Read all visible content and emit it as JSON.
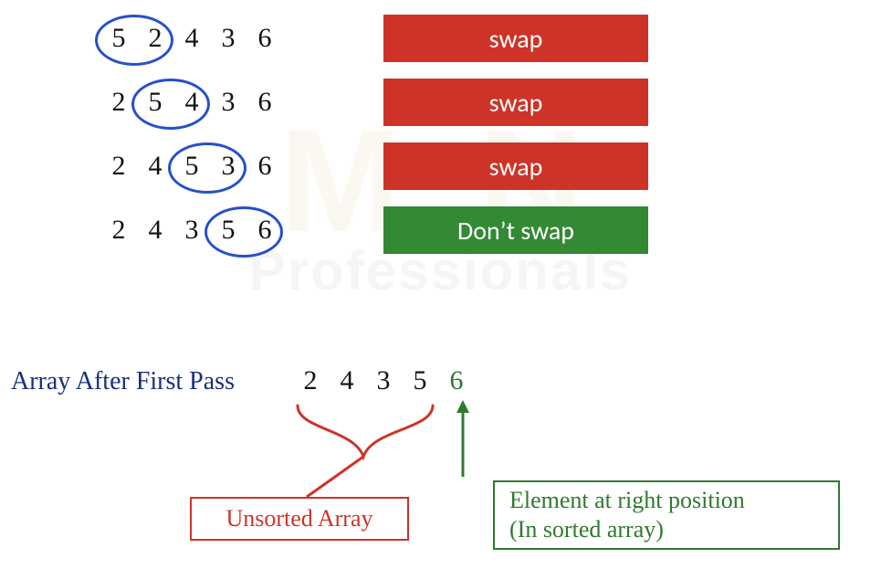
{
  "steps": [
    {
      "array": [
        "5",
        "2",
        "4",
        "3",
        "6"
      ],
      "circle": {
        "startIndex": 0,
        "span": 2
      },
      "action": "swap",
      "swap": true
    },
    {
      "array": [
        "2",
        "5",
        "4",
        "3",
        "6"
      ],
      "circle": {
        "startIndex": 1,
        "span": 2
      },
      "action": "swap",
      "swap": true
    },
    {
      "array": [
        "2",
        "4",
        "5",
        "3",
        "6"
      ],
      "circle": {
        "startIndex": 2,
        "span": 2
      },
      "action": "swap",
      "swap": true
    },
    {
      "array": [
        "2",
        "4",
        "3",
        "5",
        "6"
      ],
      "circle": {
        "startIndex": 3,
        "span": 2
      },
      "action": "Don’t swap",
      "swap": false
    }
  ],
  "passLabel": "Array After First Pass",
  "result": {
    "unsorted": [
      "2",
      "4",
      "3",
      "5"
    ],
    "sortedTail": [
      "6"
    ]
  },
  "unsortedLabel": "Unsorted Array",
  "sortedLabelLine1": "Element at right position",
  "sortedLabelLine2": "(In sorted array)",
  "colors": {
    "swap": "#cd3427",
    "noswap": "#338934",
    "circle": "#2850c8",
    "navy": "#1a2e7c",
    "green": "#2f7a2f"
  },
  "watermark": {
    "big": "M   N",
    "sub": "Professionals"
  }
}
